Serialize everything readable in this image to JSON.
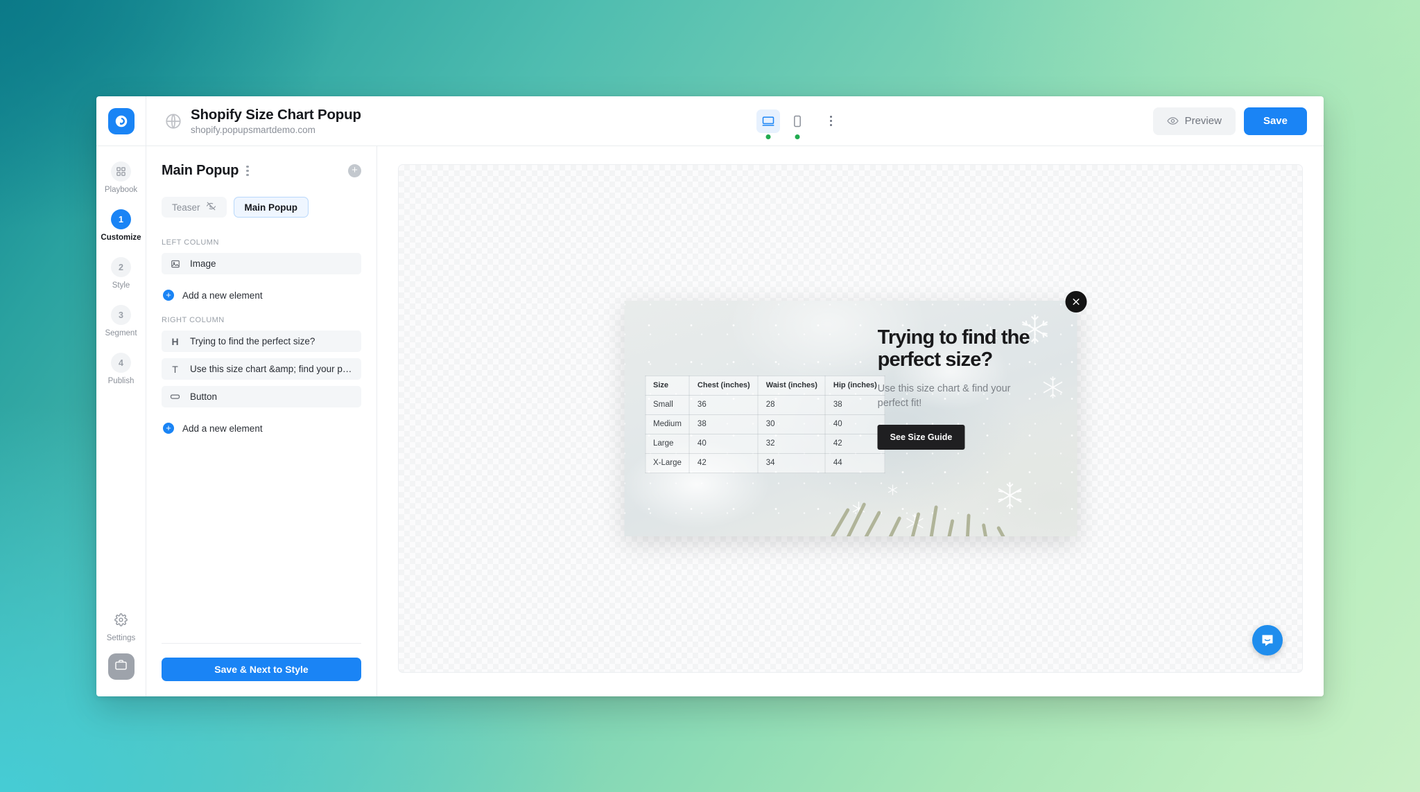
{
  "header": {
    "logo_icon": "popupsmart-logo-icon",
    "globe_icon": "globe-icon",
    "title": "Shopify Size Chart Popup",
    "domain": "shopify.popupsmartdemo.com",
    "devices": [
      {
        "icon": "desktop-icon",
        "active": true,
        "status": "online"
      },
      {
        "icon": "mobile-icon",
        "active": false,
        "status": "online"
      }
    ],
    "more_icon": "kebab-menu-icon",
    "preview_label": "Preview",
    "preview_icon": "eye-icon",
    "save_label": "Save",
    "accent_color": "#1a84f5"
  },
  "rail": {
    "items": [
      {
        "badge": "",
        "icon": "playbook-grid-icon",
        "label": "Playbook",
        "active": false
      },
      {
        "badge": "1",
        "icon": "",
        "label": "Customize",
        "active": true
      },
      {
        "badge": "2",
        "icon": "",
        "label": "Style",
        "active": false
      },
      {
        "badge": "3",
        "icon": "",
        "label": "Segment",
        "active": false
      },
      {
        "badge": "4",
        "icon": "",
        "label": "Publish",
        "active": false
      }
    ],
    "settings_label": "Settings",
    "settings_icon": "gear-icon",
    "briefcase_icon": "briefcase-icon"
  },
  "panel": {
    "title": "Main Popup",
    "kebab_icon": "kebab-menu-icon",
    "add_icon": "plus-circle-icon",
    "tabs": [
      {
        "label": "Teaser",
        "icon": "eye-off-icon",
        "selected": false
      },
      {
        "label": "Main Popup",
        "icon": "",
        "selected": true
      }
    ],
    "left_column_label": "LEFT COLUMN",
    "left_column_items": [
      {
        "icon": "image-icon",
        "label": "Image"
      }
    ],
    "left_add_label": "Add a new element",
    "right_column_label": "RIGHT COLUMN",
    "right_column_items": [
      {
        "icon": "heading-icon",
        "label": "Trying to find the perfect size?"
      },
      {
        "icon": "text-icon",
        "label": "Use this size chart &amp; find your perfect ..."
      },
      {
        "icon": "button-icon",
        "label": "Button"
      }
    ],
    "right_add_label": "Add a new element",
    "next_label": "Save & Next to Style"
  },
  "popup": {
    "close_icon": "close-icon",
    "heading": "Trying to find the perfect size?",
    "paragraph": "Use this size chart & find your perfect fit!",
    "cta_label": "See Size Guide",
    "cta_bg": "#1f1f21",
    "table": {
      "headers": [
        "Size",
        "Chest (inches)",
        "Waist (inches)",
        "Hip (inches)"
      ],
      "rows": [
        [
          "Small",
          "36",
          "28",
          "38"
        ],
        [
          "Medium",
          "38",
          "30",
          "40"
        ],
        [
          "Large",
          "40",
          "32",
          "42"
        ],
        [
          "X-Large",
          "42",
          "34",
          "44"
        ]
      ]
    }
  },
  "intercom": {
    "icon": "chat-bubble-icon",
    "color": "#1f8ded"
  }
}
